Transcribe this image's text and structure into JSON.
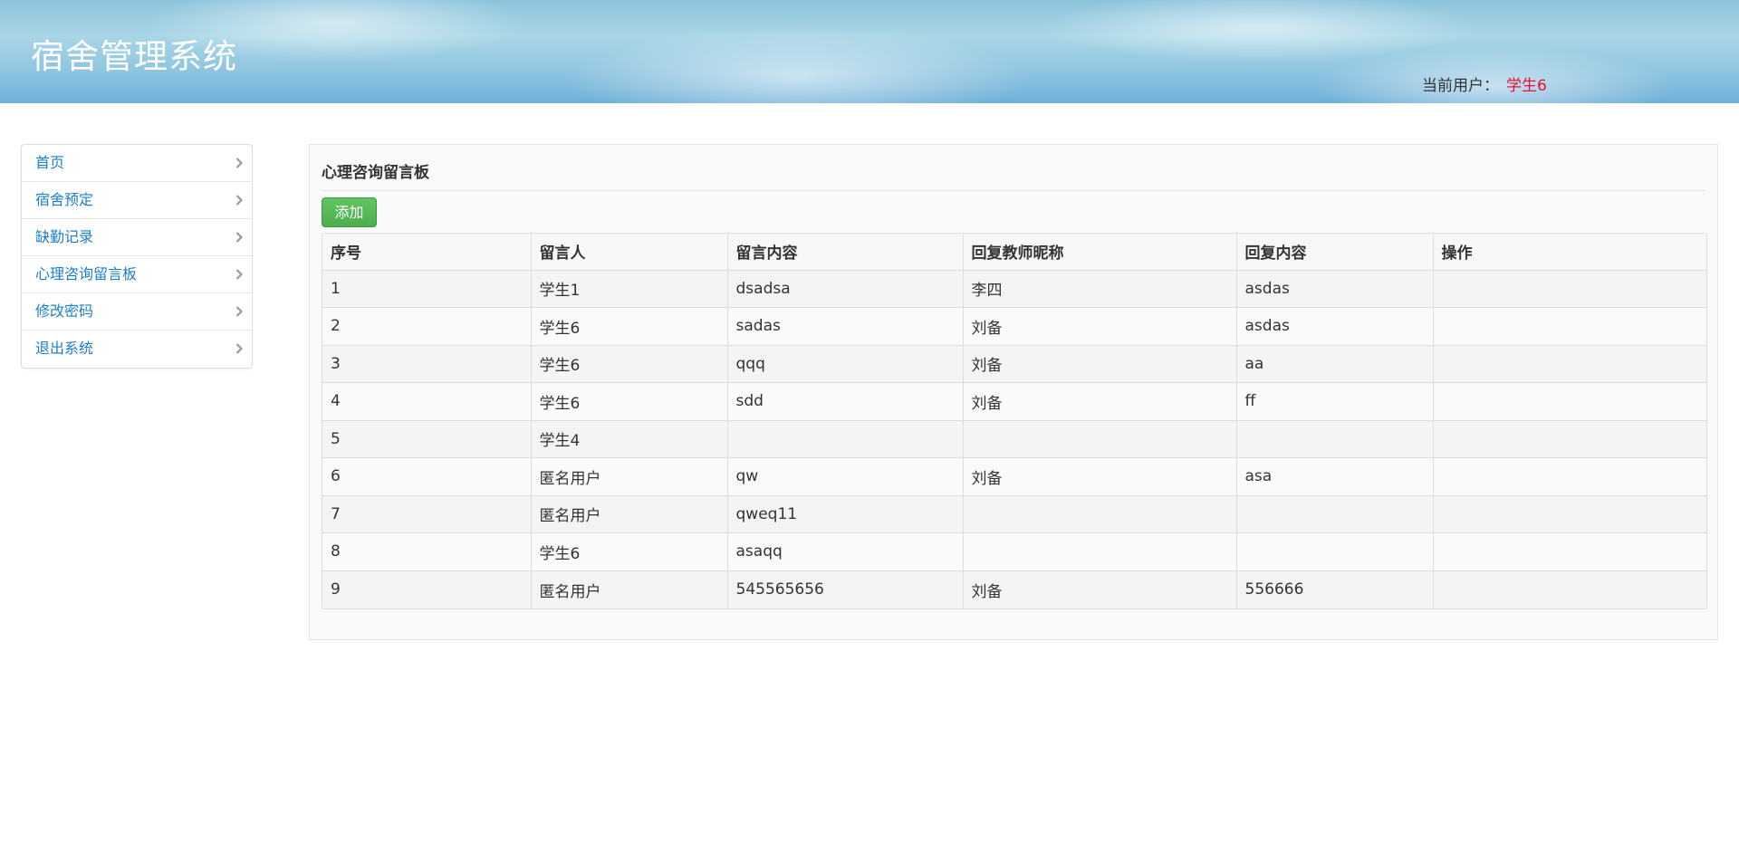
{
  "header": {
    "title": "宿舍管理系统",
    "user_label": "当前用户：",
    "user_name": "学生6",
    "user_name_color": "#e8102d"
  },
  "sidebar": {
    "items": [
      {
        "label": "首页",
        "icon": "chevron-right-icon"
      },
      {
        "label": "宿舍预定",
        "icon": "chevron-right-icon"
      },
      {
        "label": "缺勤记录",
        "icon": "chevron-right-icon"
      },
      {
        "label": "心理咨询留言板",
        "icon": "chevron-right-icon"
      },
      {
        "label": "修改密码",
        "icon": "chevron-right-icon"
      },
      {
        "label": "退出系统",
        "icon": "chevron-right-icon"
      }
    ],
    "link_color": "#1d7fc8"
  },
  "main": {
    "heading": "心理咨询留言板",
    "add_button": "添加",
    "add_button_color": "#5cb85c",
    "table": {
      "columns": [
        "序号",
        "留言人",
        "留言内容",
        "回复教师昵称",
        "回复内容",
        "操作"
      ],
      "rows": [
        [
          "1",
          "学生1",
          "dsadsa",
          "李四",
          "asdas",
          ""
        ],
        [
          "2",
          "学生6",
          "sadas",
          "刘备",
          "asdas",
          ""
        ],
        [
          "3",
          "学生6",
          "qqq",
          "刘备",
          "aa",
          ""
        ],
        [
          "4",
          "学生6",
          "sdd",
          "刘备",
          "ff",
          ""
        ],
        [
          "5",
          "学生4",
          "",
          "",
          "",
          ""
        ],
        [
          "6",
          "匿名用户",
          "qw",
          "刘备",
          "asa",
          ""
        ],
        [
          "7",
          "匿名用户",
          "qweq11",
          "",
          "",
          ""
        ],
        [
          "8",
          "学生6",
          "asaqq",
          "",
          "",
          ""
        ],
        [
          "9",
          "匿名用户",
          "545565656",
          "刘备",
          "556666",
          ""
        ]
      ]
    }
  }
}
